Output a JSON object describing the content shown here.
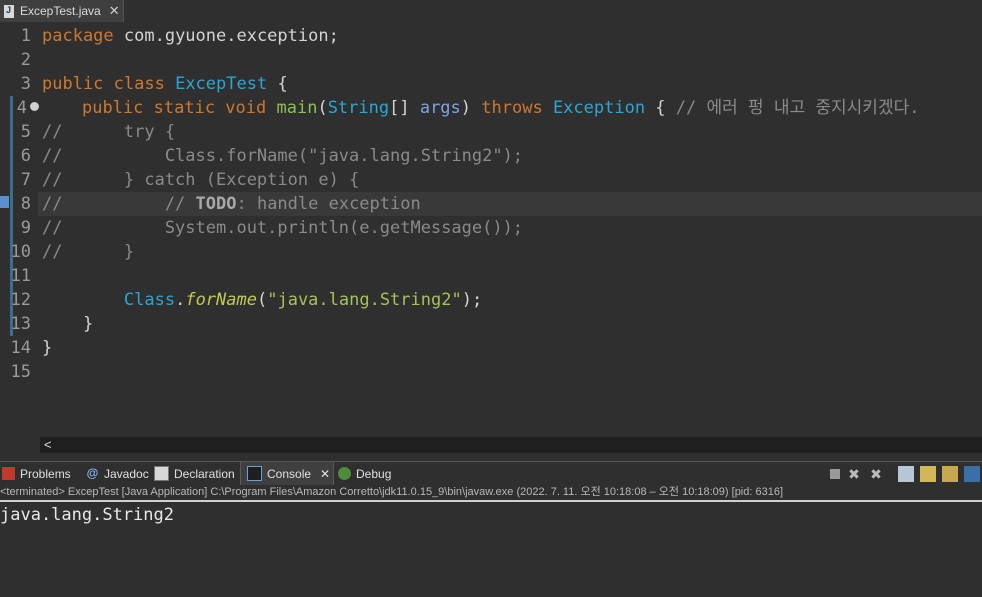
{
  "editor_tab": {
    "label": "ExcepTest.java",
    "close": "✕"
  },
  "editor": {
    "lines": [
      "1",
      "2",
      "3",
      "4",
      "5",
      "6",
      "7",
      "8",
      "9",
      "10",
      "11",
      "12",
      "13",
      "14",
      "15"
    ],
    "l1": {
      "kw": "package",
      "rest": " com.gyuone.exception;"
    },
    "l3": {
      "kw": "public class",
      "type": "ExcepTest",
      "rest": " {"
    },
    "l4": {
      "kw1": "public static void",
      "method": "main",
      "p1": "(",
      "type": "String",
      "p2": "[] ",
      "param": "args",
      "p3": ") ",
      "kw2": "throws",
      "type2": "Exception",
      "p4": " { ",
      "comment": "// 에러 펑 내고 중지시키겠다."
    },
    "l5": "//      try {",
    "l6": "//          Class.forName(\"java.lang.String2\");",
    "l7": "//      } catch (Exception e) {",
    "l8": {
      "prefix": "//          // ",
      "todo": "TODO",
      "rest": ": handle exception"
    },
    "l9": "//          System.out.println(e.getMessage());",
    "l10": "//      }",
    "l12": {
      "indent": "        ",
      "type": "Class",
      "dot": ".",
      "method": "forName",
      "p1": "(",
      "str": "\"java.lang.String2\"",
      "p2": ");"
    },
    "l13": "    }",
    "l14": "}"
  },
  "scrollbar": {
    "left_arrow": "<"
  },
  "view_tabs": {
    "problems": "Problems",
    "javadoc": "Javadoc",
    "declaration": "Declaration",
    "console": "Console",
    "console_close": "✕",
    "debug": "Debug"
  },
  "console": {
    "status": "<terminated> ExcepTest [Java Application] C:\\Program Files\\Amazon Corretto\\jdk11.0.15_9\\bin\\javaw.exe  (2022. 7. 11. 오전 10:18:08 – 오전 10:18:09) [pid: 6316]",
    "output": "java.lang.String2"
  },
  "colors": {
    "keyword": "#cc7832",
    "type": "#2ea4d4",
    "method": "#8cc152",
    "string": "#a5c25c",
    "comment": "#8a8a8a",
    "background": "#2f2f2f"
  }
}
